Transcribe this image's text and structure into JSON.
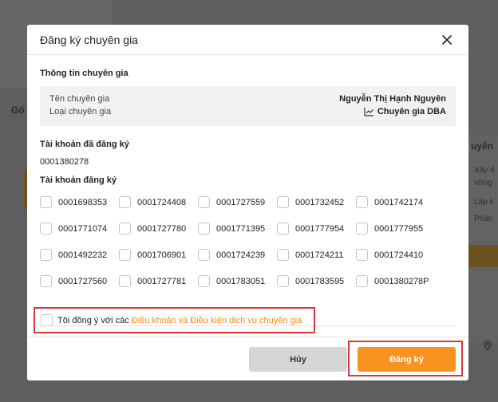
{
  "background": {
    "left_heading": "Gó",
    "right_title": "uyên",
    "right_lines": [
      "Xây d",
      "vững",
      "Lập k",
      "Phân"
    ]
  },
  "modal": {
    "title": "Đăng ký chuyên gia",
    "expert_info_title": "Thông tin chuyên gia",
    "expert_name_label": "Tên chuyên gia",
    "expert_name_value": "Nguyễn Thị Hạnh Nguyên",
    "expert_type_label": "Loại chuyên gia",
    "expert_type_value": "Chuyên gia DBA",
    "registered_title": "Tài khoản đã đăng ký",
    "registered_account": "0001380278",
    "register_title": "Tài khoản đăng ký",
    "accounts": [
      "0001698353",
      "0001724408",
      "0001727559",
      "0001732452",
      "0001742174",
      "0001771074",
      "0001727780",
      "0001771395",
      "0001777954",
      "0001777955",
      "0001492232",
      "0001706901",
      "0001724239",
      "0001724211",
      "0001724410",
      "0001727560",
      "0001727781",
      "0001783051",
      "0001783595",
      "0001380278P"
    ],
    "agree_prefix": "Tôi đồng ý với các ",
    "agree_link": "Điều khoản và Điều kiện dịch vụ chuyên gia",
    "cancel_label": "Hủy",
    "submit_label": "Đăng ký"
  },
  "colors": {
    "accent": "#f7931e",
    "highlight_border": "#d9373a",
    "cancel_bg": "#d6d6d6"
  },
  "icons": {
    "close": "close-icon",
    "expert_type": "trend-chart-icon",
    "location": "location-pin-icon"
  }
}
